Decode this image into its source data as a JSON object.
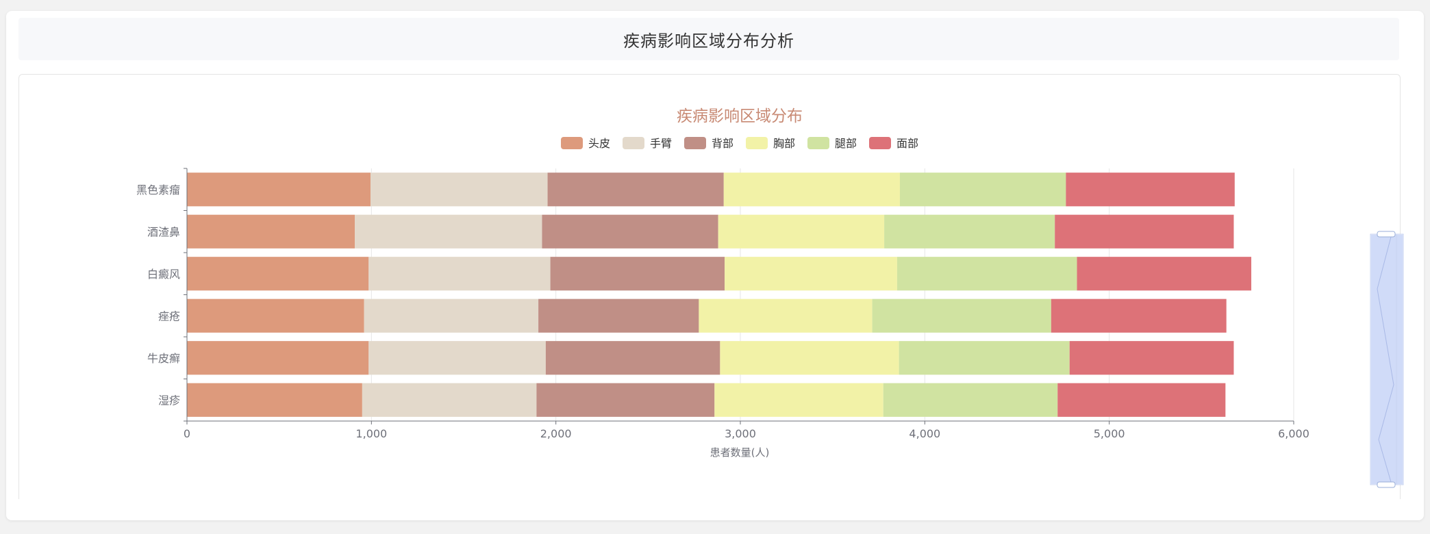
{
  "page": {
    "title": "疾病影响区域分布分析"
  },
  "chart_data": {
    "type": "bar",
    "orientation": "horizontal",
    "stacked": true,
    "title": "疾病影响区域分布",
    "xlabel": "患者数量(人)",
    "ylabel": "",
    "xlim": [
      0,
      6000
    ],
    "xticks": [
      0,
      1000,
      2000,
      3000,
      4000,
      5000,
      6000
    ],
    "xtick_labels": [
      "0",
      "1,000",
      "2,000",
      "3,000",
      "4,000",
      "5,000",
      "6,000"
    ],
    "grid": true,
    "legend_position": "top-center",
    "categories": [
      "湿疹",
      "牛皮癣",
      "痤疮",
      "白癜风",
      "酒渣鼻",
      "黑色素瘤"
    ],
    "series": [
      {
        "name": "头皮",
        "color": "#dd9a7c",
        "values": [
          950,
          985,
          960,
          985,
          910,
          995
        ]
      },
      {
        "name": "手臂",
        "color": "#e3d9cb",
        "values": [
          945,
          960,
          945,
          985,
          1015,
          960
        ]
      },
      {
        "name": "背部",
        "color": "#c08f86",
        "values": [
          965,
          945,
          870,
          945,
          955,
          955
        ]
      },
      {
        "name": "胸部",
        "color": "#f2f2a7",
        "values": [
          915,
          970,
          940,
          935,
          900,
          955
        ]
      },
      {
        "name": "腿部",
        "color": "#d0e3a1",
        "values": [
          945,
          925,
          970,
          975,
          925,
          900
        ]
      },
      {
        "name": "面部",
        "color": "#dd7278",
        "values": [
          910,
          890,
          950,
          945,
          970,
          915
        ]
      }
    ]
  }
}
